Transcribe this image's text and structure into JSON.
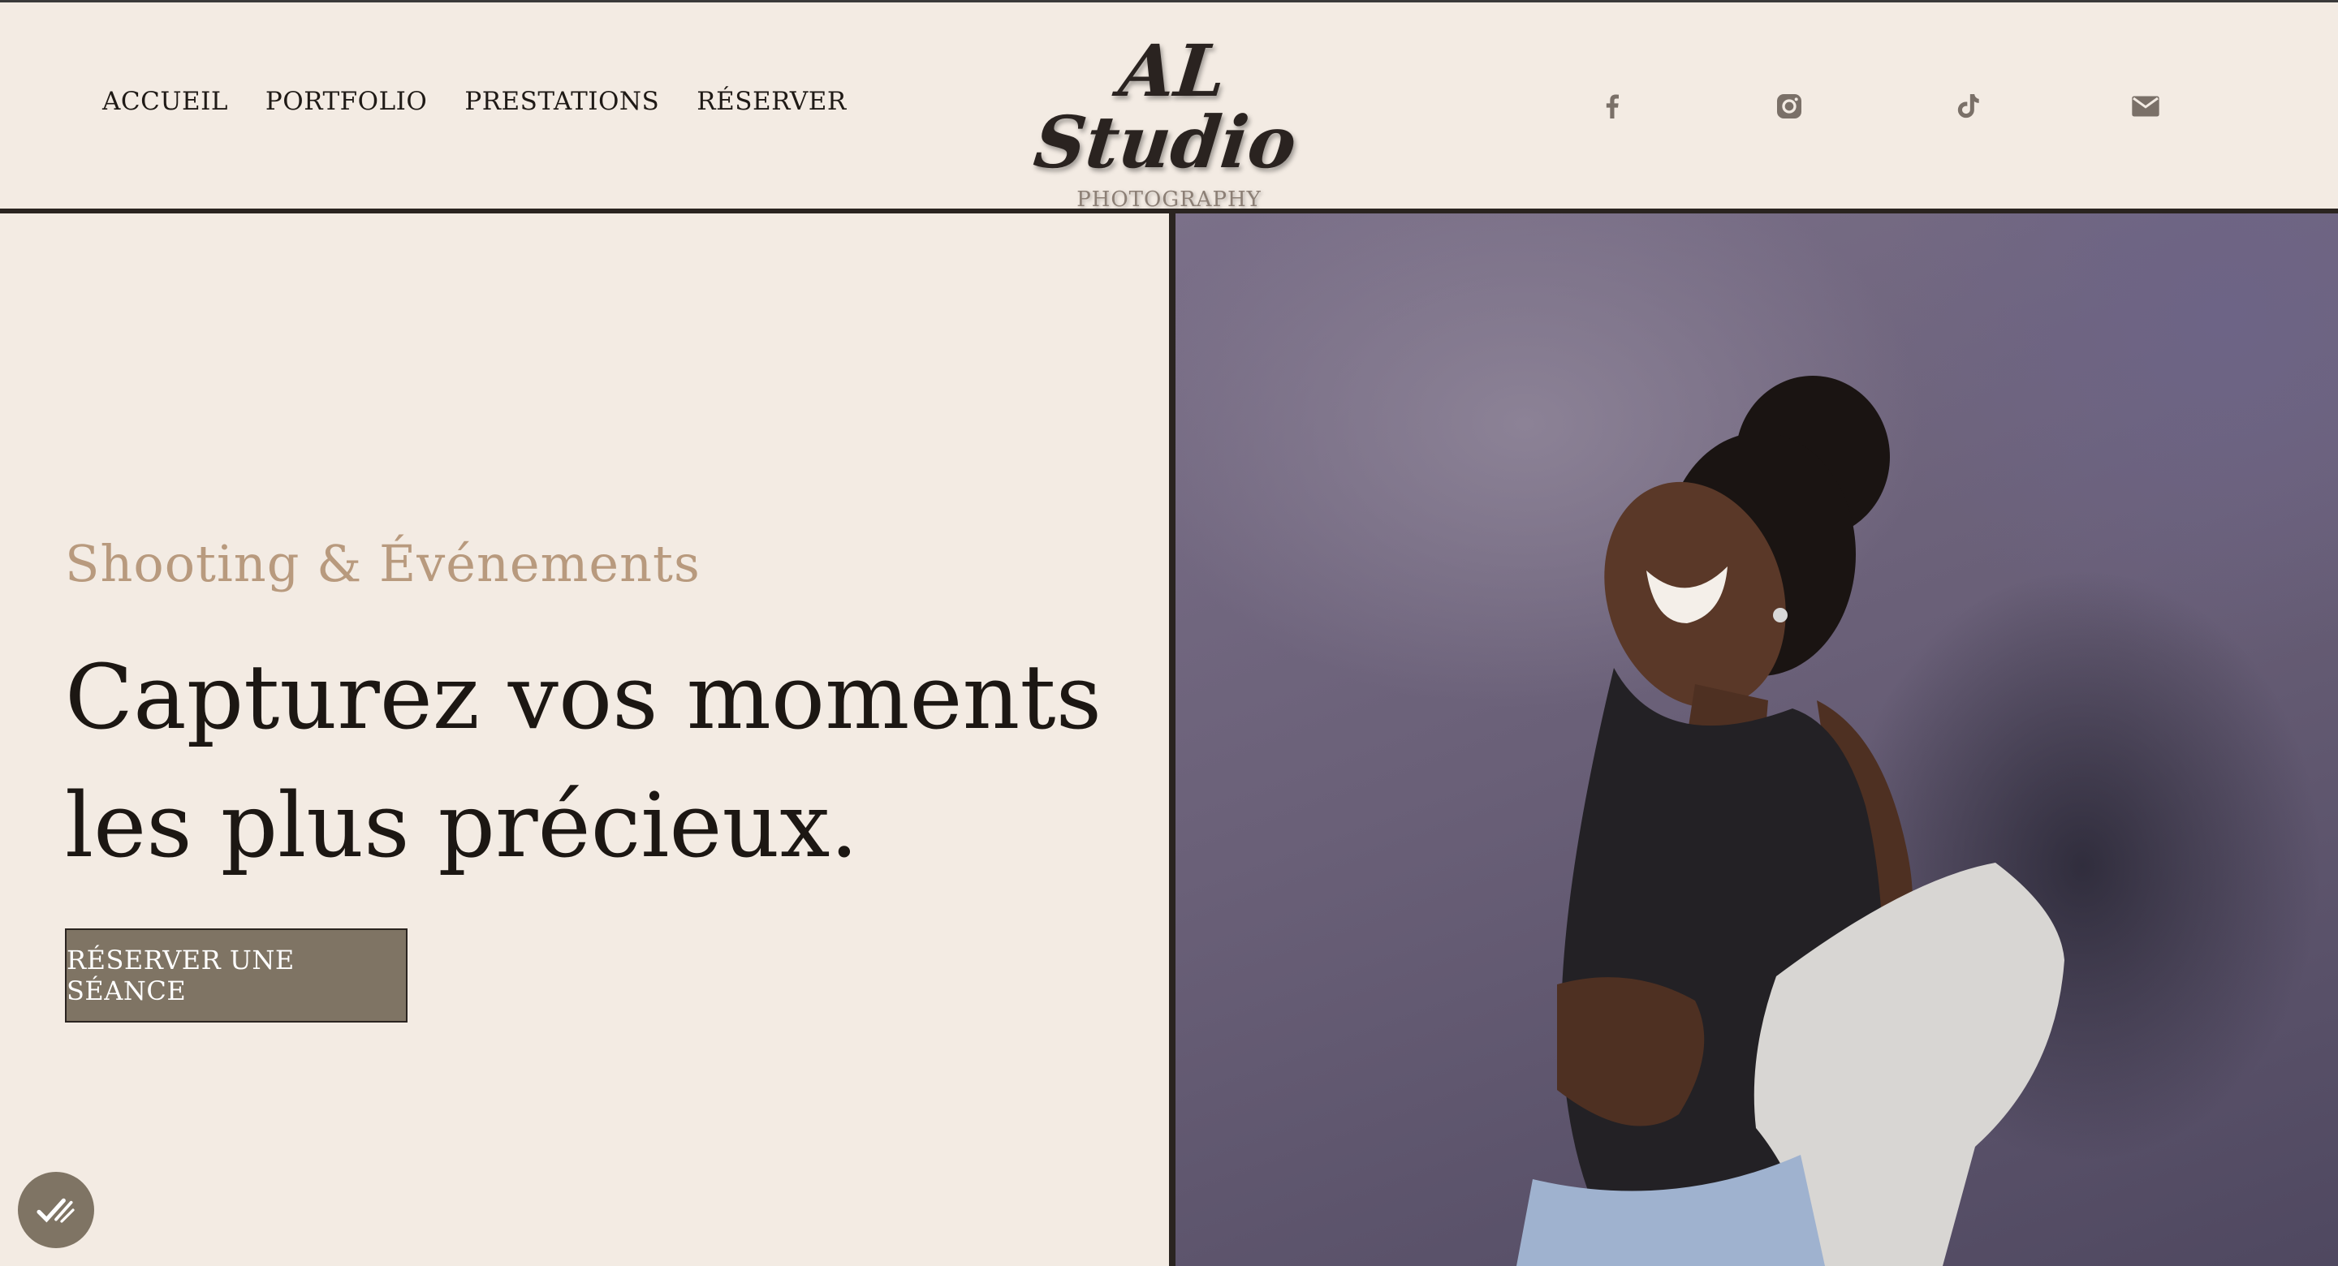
{
  "nav": {
    "items": [
      {
        "label": "ACCUEIL"
      },
      {
        "label": "PORTFOLIO"
      },
      {
        "label": "PRESTATIONS"
      },
      {
        "label": "RÉSERVER"
      }
    ]
  },
  "logo": {
    "main": "AL Studio",
    "sub": "PHOTOGRAPHY"
  },
  "social": [
    {
      "icon": "facebook-icon"
    },
    {
      "icon": "instagram-icon"
    },
    {
      "icon": "tiktok-icon"
    },
    {
      "icon": "mail-icon"
    }
  ],
  "hero": {
    "eyebrow": "Shooting & Événements",
    "headline": "Capturez vos moments les plus précieux.",
    "cta_label": "RÉSERVER UNE SÉANCE"
  },
  "colors": {
    "background": "#f3ebe3",
    "accent": "#b89a7e",
    "button": "#7f7464",
    "text": "#1c1713",
    "icon": "#7a7068"
  }
}
